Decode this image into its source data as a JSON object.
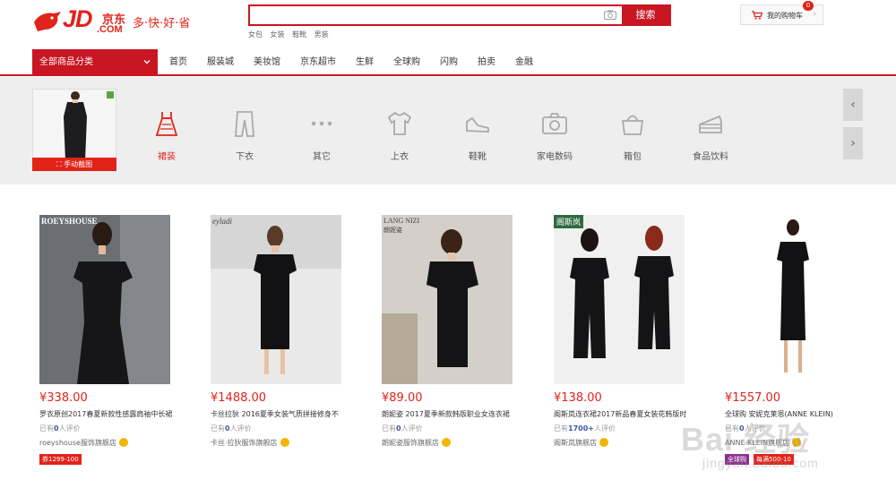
{
  "header": {
    "logo_text": "JD",
    "logo_cn": "京东",
    "logo_dotcom": ".COM",
    "slogan": "多·快·好·省",
    "search_button": "搜索",
    "hot_keywords": [
      "女包",
      "女装",
      "鞋靴",
      "男装"
    ],
    "cart_label": "我的购物车",
    "cart_count": "0"
  },
  "nav": {
    "all_categories": "全部商品分类",
    "items": [
      "首页",
      "服装城",
      "美妆馆",
      "京东超市",
      "生鲜",
      "全球购",
      "闪购",
      "拍卖",
      "金融"
    ]
  },
  "category_bar": {
    "crop_button": "手动截图",
    "categories": [
      {
        "label": "裙装",
        "icon": "dress-icon",
        "active": true
      },
      {
        "label": "下衣",
        "icon": "pants-icon",
        "active": false
      },
      {
        "label": "其它",
        "icon": "more-dots-icon",
        "active": false
      },
      {
        "label": "上衣",
        "icon": "tshirt-icon",
        "active": false
      },
      {
        "label": "鞋靴",
        "icon": "shoe-icon",
        "active": false
      },
      {
        "label": "家电数码",
        "icon": "camera-icon",
        "active": false
      },
      {
        "label": "箱包",
        "icon": "bag-icon",
        "active": false
      },
      {
        "label": "食品饮料",
        "icon": "cake-icon",
        "active": false
      }
    ],
    "accent_color": "#e2231a"
  },
  "products": [
    {
      "brand": "ROEYSHOUSE",
      "price": "¥338.00",
      "name": "罗衣原创2017春夏新款性感露肩袖中长裙",
      "reviews_prefix": "已有",
      "reviews_count": "0",
      "reviews_suffix": "人评价",
      "shop": "roeyshouse服饰旗舰店",
      "tag": "券1299-100"
    },
    {
      "brand": "eyladi",
      "price": "¥1488.00",
      "name": "卡丝拉狄 2016夏季女装气质拼接修身不",
      "reviews_prefix": "已有",
      "reviews_count": "0",
      "reviews_suffix": "人评价",
      "shop": "卡丝·拉狄服饰旗舰店",
      "tag": ""
    },
    {
      "brand": "LANG NIZI",
      "brand_sub": "朗妮姿",
      "price": "¥89.00",
      "name": "朗妮姿 2017夏季新款韩版职业女连衣裙",
      "reviews_prefix": "已有",
      "reviews_count": "0",
      "reviews_suffix": "人评价",
      "shop": "朗妮姿服饰旗舰店",
      "tag": ""
    },
    {
      "brand": "阁斯岚",
      "price": "¥138.00",
      "name": "阁斯岚连衣裙2017新品春夏女装花韩版时",
      "reviews_prefix": "已有",
      "reviews_count": "1700+",
      "reviews_suffix": "人评价",
      "shop": "阁斯岚旗舰店",
      "tag": ""
    },
    {
      "brand": "",
      "price": "¥1557.00",
      "name": "全球购 安妮克莱恩(ANNE KLEIN)",
      "reviews_prefix": "已有",
      "reviews_count": "0",
      "reviews_suffix": "人评价",
      "shop": "ANNE KLEIN旗舰店",
      "tag": "每满500-10",
      "tag2": "全球购"
    }
  ],
  "watermark": {
    "line1": "Bai 经验",
    "line2": "jingyan.baidu.com"
  }
}
